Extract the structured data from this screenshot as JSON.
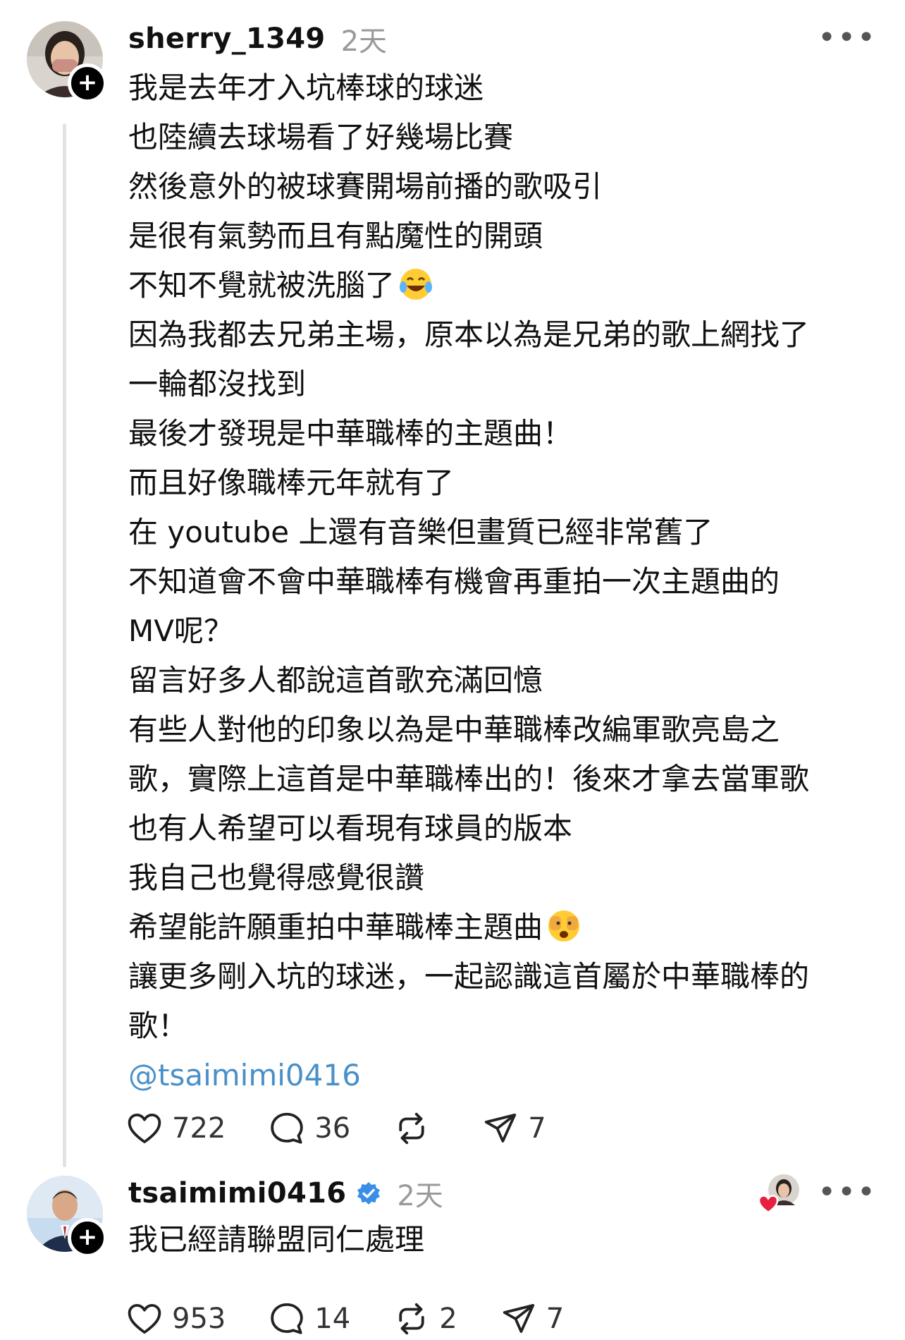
{
  "post1": {
    "username": "sherry_1349",
    "time": "2天",
    "lines": [
      "我是去年才入坑棒球的球迷",
      "也陸續去球場看了好幾場比賽",
      "然後意外的被球賽開場前播的歌吸引",
      "是很有氣勢而且有點魔性的開頭",
      "不知不覺就被洗腦了",
      "因為我都去兄弟主場，原本以為是兄弟的歌上網找了",
      "一輪都沒找到",
      "最後才發現是中華職棒的主題曲！",
      "而且好像職棒元年就有了",
      "在 youtube 上還有音樂但畫質已經非常舊了",
      "不知道會不會中華職棒有機會再重拍一次主題曲的",
      "MV呢？",
      "留言好多人都說這首歌充滿回憶",
      "有些人對他的印象以為是中華職棒改編軍歌亮島之",
      "歌，實際上這首是中華職棒出的！後來才拿去當軍歌",
      "也有人希望可以看現有球員的版本",
      "我自己也覺得感覺很讚",
      "希望能許願重拍中華職棒主題曲",
      "讓更多剛入坑的球迷，一起認識這首屬於中華職棒的",
      "歌！"
    ],
    "mention": "@tsaimimi0416",
    "likes": "722",
    "comments": "36",
    "reposts": "",
    "shares": "7"
  },
  "post2": {
    "username": "tsaimimi0416",
    "time": "2天",
    "text": "我已經請聯盟同仁處理",
    "likes": "953",
    "comments": "14",
    "reposts": "2",
    "shares": "7"
  },
  "icons": {
    "more": "more-icon",
    "like": "heart-icon",
    "comment": "comment-icon",
    "repost": "repost-icon",
    "share": "share-icon",
    "follow": "plus-icon",
    "verified": "verified-badge-icon",
    "emoji_laugh": "tears-of-joy-emoji",
    "emoji_peek": "face-peeking-emoji"
  },
  "colors": {
    "mention": "#4a90c8",
    "verified": "#3b8ee6",
    "liked_heart": "#e8203f"
  }
}
